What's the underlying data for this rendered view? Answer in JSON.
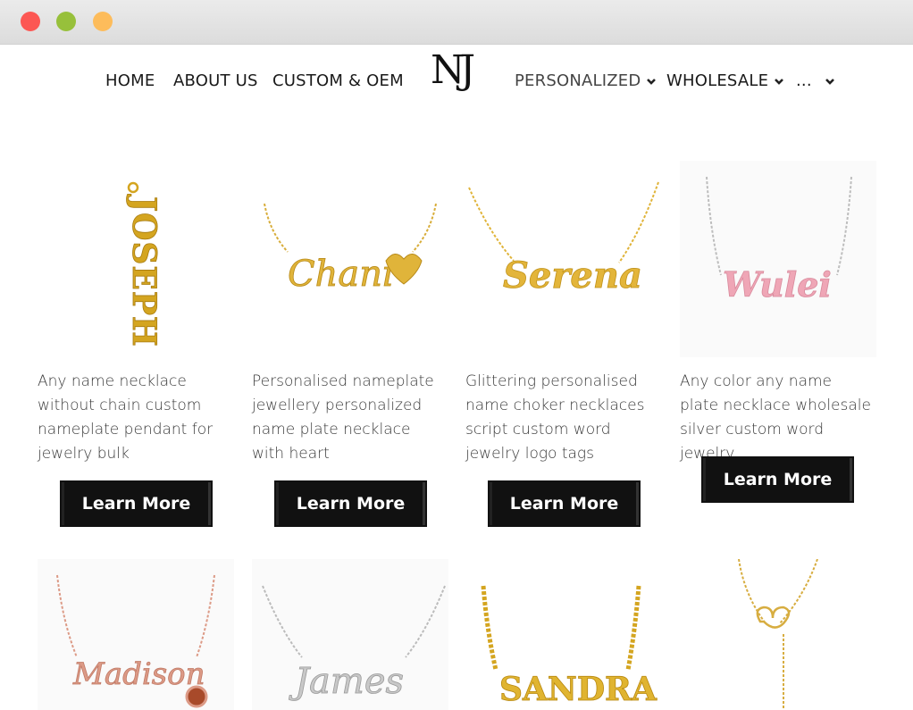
{
  "window": {
    "controls": [
      "close",
      "minimize",
      "maximize"
    ]
  },
  "nav": {
    "home": "HOME",
    "about": "ABOUT US",
    "custom": "CUSTOM & OEM",
    "logo": "NJ",
    "personalized": "PERSONALIZED",
    "wholesale": "WHOLESALE",
    "more": "..."
  },
  "products": [
    {
      "name": "JOSEPH",
      "description": "Any name necklace without chain custom nameplate pendant for jewelry bulk",
      "button": "Learn More",
      "color": "#d4a520"
    },
    {
      "name": "Chani",
      "description": "Personalised nameplate jewellery personalized name plate necklace with heart",
      "button": "Learn More",
      "color": "#e0b43a"
    },
    {
      "name": "Serena",
      "description": "Glittering personalised name choker necklaces script custom word jewelry logo tags",
      "button": "Learn More",
      "color": "#e3b53a"
    },
    {
      "name": "Wulei",
      "description": "Any color any name plate necklace wholesale silver custom word jewelry",
      "button": "Learn More",
      "color": "#efa6b6"
    },
    {
      "name": "Madison",
      "color": "#dc9a86"
    },
    {
      "name": "James",
      "color": "#b8b8b8"
    },
    {
      "name": "SANDRA",
      "color": "#e0b430"
    },
    {
      "name": "",
      "color": "#d7ad40"
    }
  ]
}
